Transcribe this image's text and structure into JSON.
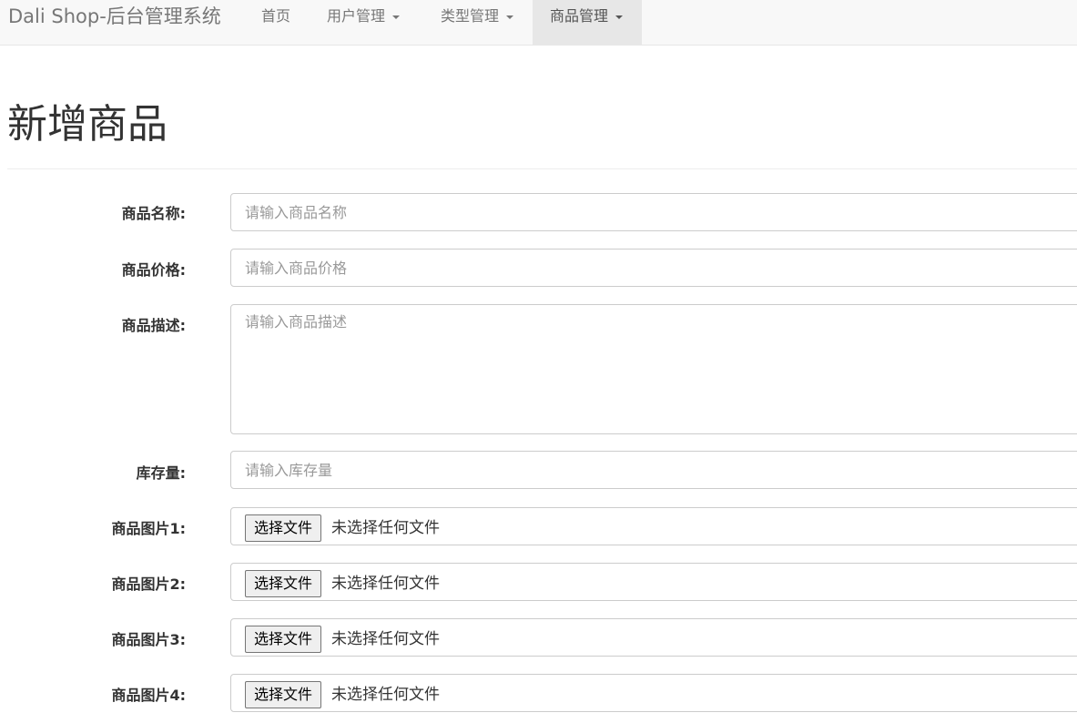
{
  "navbar": {
    "brand": "Dali Shop-后台管理系统",
    "items": [
      {
        "label": "首页",
        "has_caret": false,
        "active": false
      },
      {
        "label": "用户管理",
        "has_caret": true,
        "active": false
      },
      {
        "label": "类型管理",
        "has_caret": true,
        "active": false
      },
      {
        "label": "商品管理",
        "has_caret": true,
        "active": true
      }
    ]
  },
  "page": {
    "title": "新增商品"
  },
  "form": {
    "name": {
      "label": "商品名称:",
      "placeholder": "请输入商品名称",
      "value": ""
    },
    "price": {
      "label": "商品价格:",
      "placeholder": "请输入商品价格",
      "value": ""
    },
    "description": {
      "label": "商品描述:",
      "placeholder": "请输入商品描述",
      "value": ""
    },
    "stock": {
      "label": "库存量:",
      "placeholder": "请输入库存量",
      "value": ""
    },
    "images": [
      {
        "label": "商品图片1:",
        "button": "选择文件",
        "status": "未选择任何文件"
      },
      {
        "label": "商品图片2:",
        "button": "选择文件",
        "status": "未选择任何文件"
      },
      {
        "label": "商品图片3:",
        "button": "选择文件",
        "status": "未选择任何文件"
      },
      {
        "label": "商品图片4:",
        "button": "选择文件",
        "status": "未选择任何文件"
      }
    ]
  },
  "colors": {
    "navbar_bg": "#f8f8f8",
    "nav_active_bg": "#e7e7e7",
    "nav_text": "#777777",
    "input_border": "#cccccc",
    "placeholder": "#999999"
  }
}
